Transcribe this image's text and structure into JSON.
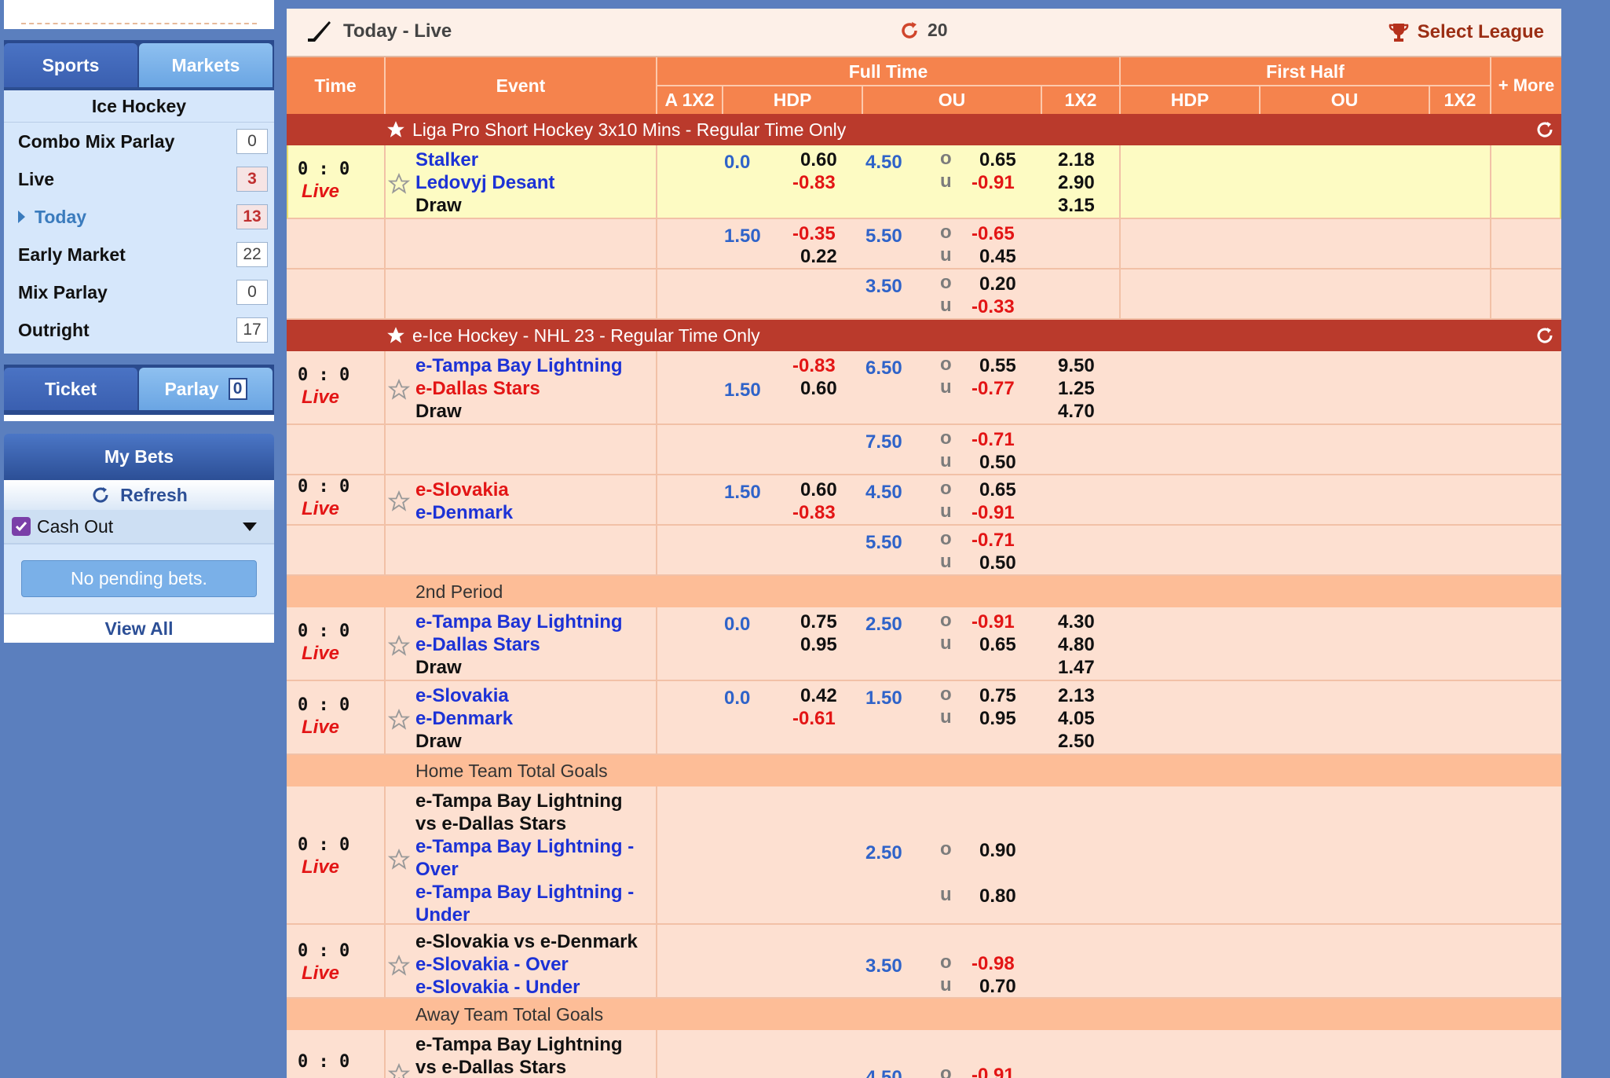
{
  "sidebar": {
    "tabs": [
      "Sports",
      "Markets"
    ],
    "category": "Ice Hockey",
    "items": [
      {
        "label": "Combo Mix Parlay",
        "count": "0"
      },
      {
        "label": "Live",
        "count": "3"
      },
      {
        "label": "Today",
        "count": "13"
      },
      {
        "label": "Early Market",
        "count": "22"
      },
      {
        "label": "Mix Parlay",
        "count": "0"
      },
      {
        "label": "Outright",
        "count": "17"
      }
    ],
    "ticket_tab": "Ticket",
    "parlay_tab": "Parlay",
    "parlay_count": "0",
    "mybets": "My Bets",
    "refresh": "Refresh",
    "cashout": "Cash Out",
    "pending": "No pending bets.",
    "viewall": "View All"
  },
  "header": {
    "title": "Today - Live",
    "refresh_count": "20",
    "select_league": "Select League"
  },
  "columns": {
    "time": "Time",
    "event": "Event",
    "full_time": "Full Time",
    "first_half": "First Half",
    "more": "+ More",
    "a1x2": "A 1X2",
    "hdp": "HDP",
    "ou": "OU",
    "x12": "1X2"
  },
  "leagues": [
    "Liga Pro Short Hockey 3x10 Mins - Regular Time Only",
    "e-Ice Hockey - NHL 23 - Regular Time Only"
  ],
  "subheaders": [
    "2nd Period",
    "Home Team Total Goals",
    "Away Team Total Goals"
  ],
  "score": "0 : 0",
  "live": "Live",
  "teams": {
    "stalker": "Stalker",
    "ledovyj": "Ledovyj Desant",
    "draw": "Draw",
    "tampa": "e-Tampa Bay Lightning",
    "dallas": "e-Dallas Stars",
    "slovakia": "e-Slovakia",
    "denmark": "e-Denmark",
    "tampa_vs1": "e-Tampa Bay Lightning",
    "tampa_vs2": "vs e-Dallas Stars",
    "tampa_over1": "e-Tampa Bay Lightning -",
    "tampa_over2": "Over",
    "tampa_under1": "e-Tampa Bay Lightning -",
    "tampa_under2": "Under",
    "slo_vs": "e-Slovakia vs e-Denmark",
    "slo_over": "e-Slovakia - Over",
    "slo_under": "e-Slovakia - Under"
  },
  "o": "o",
  "u": "u",
  "odds": {
    "r1": {
      "hdp": "0.0",
      "h1": "0.60",
      "h2": "-0.83",
      "ou": "4.50",
      "o1": "0.65",
      "o2": "-0.91",
      "x1": "2.18",
      "x2": "2.90",
      "x3": "3.15"
    },
    "r2": {
      "hdp": "1.50",
      "h1": "-0.35",
      "h2": "0.22",
      "ou": "5.50",
      "o1": "-0.65",
      "o2": "0.45"
    },
    "r3": {
      "ou": "3.50",
      "o1": "0.20",
      "o2": "-0.33"
    },
    "r4": {
      "hdp": "1.50",
      "h1": "-0.83",
      "h2": "0.60",
      "ou": "6.50",
      "o1": "0.55",
      "o2": "-0.77",
      "x1": "9.50",
      "x2": "1.25",
      "x3": "4.70"
    },
    "r5": {
      "ou": "7.50",
      "o1": "-0.71",
      "o2": "0.50"
    },
    "r6": {
      "hdp": "1.50",
      "h1": "0.60",
      "h2": "-0.83",
      "ou": "4.50",
      "o1": "0.65",
      "o2": "-0.91"
    },
    "r7": {
      "ou": "5.50",
      "o1": "-0.71",
      "o2": "0.50"
    },
    "r8": {
      "hdp": "0.0",
      "h1": "0.75",
      "h2": "0.95",
      "ou": "2.50",
      "o1": "-0.91",
      "o2": "0.65",
      "x1": "4.30",
      "x2": "4.80",
      "x3": "1.47"
    },
    "r9": {
      "hdp": "0.0",
      "h1": "0.42",
      "h2": "-0.61",
      "ou": "1.50",
      "o1": "0.75",
      "o2": "0.95",
      "x1": "2.13",
      "x2": "4.05",
      "x3": "2.50"
    },
    "r10": {
      "ou": "2.50",
      "o1": "0.90",
      "o2": "0.80"
    },
    "r11": {
      "ou": "3.50",
      "o1": "-0.98",
      "o2": "0.70"
    },
    "r12": {
      "ou": "4.50",
      "o1": "-0.91"
    }
  }
}
